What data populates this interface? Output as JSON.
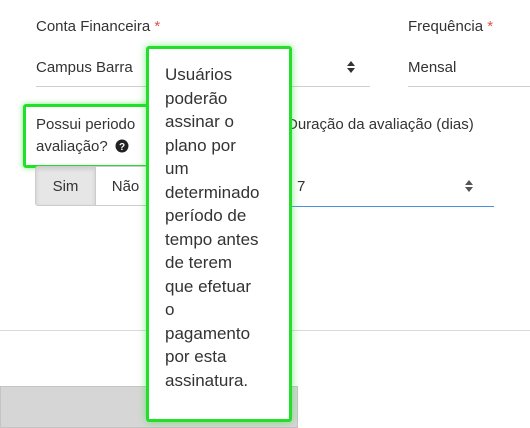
{
  "form": {
    "conta": {
      "label": "Conta Financeira",
      "required_mark": "*",
      "value": "Campus Barra"
    },
    "frequencia": {
      "label": "Frequência",
      "required_mark": "*",
      "value": "Mensal"
    },
    "trial": {
      "label_line1": "Possui periodo",
      "label_line2": "avaliação?",
      "help_icon": "question-circle-icon",
      "options": [
        "Sim",
        "Não"
      ],
      "selected": "Sim"
    },
    "duracao": {
      "label": "Duração da avaliação (dias)",
      "value": "7"
    }
  },
  "tooltip": {
    "text": "Usuários\npoderão\nassinar o\nplano por\num\ndeterminado\nperíodo de\ntempo antes\nde terem\nque efetuar\no\npagamento\npor esta\nassinatura."
  },
  "colors": {
    "highlight": "#22e02a",
    "required": "#d9534f",
    "active_underline": "#4a90d9"
  }
}
